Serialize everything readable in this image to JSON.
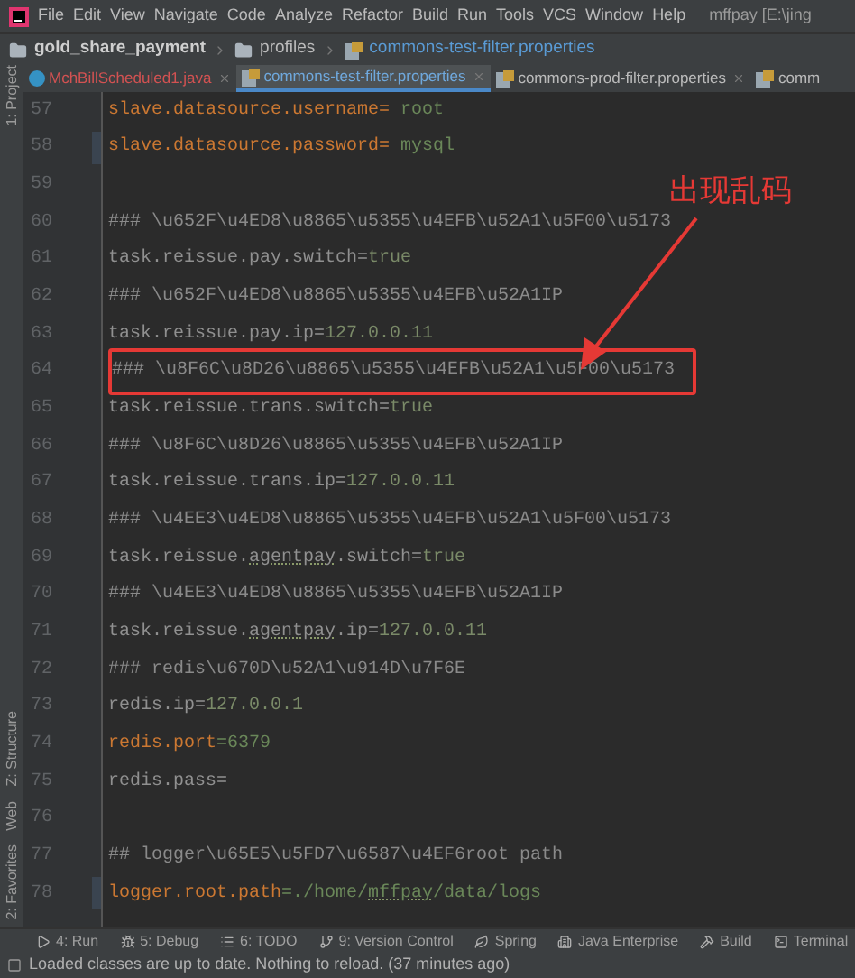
{
  "menu": {
    "items": [
      "File",
      "Edit",
      "View",
      "Navigate",
      "Code",
      "Analyze",
      "Refactor",
      "Build",
      "Run",
      "Tools",
      "VCS",
      "Window",
      "Help"
    ],
    "title": "mffpay [E:\\jing"
  },
  "breadcrumb": [
    {
      "label": "gold_share_payment",
      "kind": "project"
    },
    {
      "label": "profiles",
      "kind": "folder"
    },
    {
      "label": "commons-test-filter.properties",
      "kind": "file"
    }
  ],
  "side_tabs": {
    "top": [
      "1: Project"
    ],
    "bottom": [
      "Z: Structure",
      "Web",
      "2: Favorites"
    ]
  },
  "tabs": [
    {
      "label": "MchBillScheduled1.java",
      "kind": "java",
      "selected": false
    },
    {
      "label": "commons-test-filter.properties",
      "kind": "properties",
      "selected": true
    },
    {
      "label": "commons-prod-filter.properties",
      "kind": "properties",
      "selected": false
    },
    {
      "label": "comm",
      "kind": "properties",
      "selected": false
    }
  ],
  "lines": [
    {
      "number": "57",
      "modified": false,
      "boxed": false,
      "segments": [
        {
          "text": "slave.datasource.username=",
          "kind": "key"
        },
        {
          "text": " root",
          "kind": "value"
        }
      ]
    },
    {
      "number": "58",
      "modified": true,
      "boxed": false,
      "segments": [
        {
          "text": "slave.datasource.password=",
          "kind": "key"
        },
        {
          "text": " mysql",
          "kind": "value"
        }
      ]
    },
    {
      "number": "59",
      "modified": false,
      "boxed": false
    },
    {
      "number": "60",
      "modified": false,
      "boxed": false,
      "segments": [
        {
          "text": "### \\u652F\\u4ED8\\u8865\\u5355\\u4EFB\\u52A1\\u5F00\\u5173",
          "kind": "comment"
        }
      ]
    },
    {
      "number": "61",
      "modified": false,
      "boxed": false,
      "segments": [
        {
          "text": "task.reissue.pay.switch=",
          "kind": "unused_key"
        },
        {
          "text": "true",
          "kind": "unused_value"
        }
      ]
    },
    {
      "number": "62",
      "modified": false,
      "boxed": false,
      "segments": [
        {
          "text": "### \\u652F\\u4ED8\\u8865\\u5355\\u4EFB\\u52A1IP",
          "kind": "comment"
        }
      ]
    },
    {
      "number": "63",
      "modified": false,
      "boxed": false,
      "segments": [
        {
          "text": "task.reissue.pay.ip=",
          "kind": "unused_key"
        },
        {
          "text": "127.0.0.11",
          "kind": "unused_value"
        }
      ]
    },
    {
      "number": "64",
      "modified": false,
      "boxed": true,
      "segments": [
        {
          "text": "### \\u8F6C\\u8D26\\u8865\\u5355\\u4EFB\\u52A1\\u5F00\\u5173",
          "kind": "comment"
        }
      ]
    },
    {
      "number": "65",
      "modified": false,
      "boxed": false,
      "segments": [
        {
          "text": "task.reissue.trans.switch=",
          "kind": "unused_key"
        },
        {
          "text": "true",
          "kind": "unused_value"
        }
      ]
    },
    {
      "number": "66",
      "modified": false,
      "boxed": false,
      "segments": [
        {
          "text": "### \\u8F6C\\u8D26\\u8865\\u5355\\u4EFB\\u52A1IP",
          "kind": "comment"
        }
      ]
    },
    {
      "number": "67",
      "modified": false,
      "boxed": false,
      "segments": [
        {
          "text": "task.reissue.trans.ip=",
          "kind": "unused_key"
        },
        {
          "text": "127.0.0.11",
          "kind": "unused_value"
        }
      ]
    },
    {
      "number": "68",
      "modified": false,
      "boxed": false,
      "segments": [
        {
          "text": "### \\u4EE3\\u4ED8\\u8865\\u5355\\u4EFB\\u52A1\\u5F00\\u5173",
          "kind": "comment"
        }
      ]
    },
    {
      "number": "69",
      "modified": false,
      "boxed": false,
      "segments": [
        {
          "text": "task.reissue.",
          "kind": "unused_key"
        },
        {
          "text": "agentpay",
          "kind": "typo_key"
        },
        {
          "text": ".switch=",
          "kind": "unused_key"
        },
        {
          "text": "true",
          "kind": "unused_value"
        }
      ]
    },
    {
      "number": "70",
      "modified": false,
      "boxed": false,
      "segments": [
        {
          "text": "### \\u4EE3\\u4ED8\\u8865\\u5355\\u4EFB\\u52A1IP",
          "kind": "comment"
        }
      ]
    },
    {
      "number": "71",
      "modified": false,
      "boxed": false,
      "segments": [
        {
          "text": "task.reissue.",
          "kind": "unused_key"
        },
        {
          "text": "agentpay",
          "kind": "typo_key"
        },
        {
          "text": ".ip=",
          "kind": "unused_key"
        },
        {
          "text": "127.0.0.11",
          "kind": "unused_value"
        }
      ]
    },
    {
      "number": "72",
      "modified": false,
      "boxed": false,
      "segments": [
        {
          "text": "### redis\\u670D\\u52A1\\u914D\\u7F6E",
          "kind": "comment"
        }
      ]
    },
    {
      "number": "73",
      "modified": false,
      "boxed": false,
      "segments": [
        {
          "text": "redis.ip=",
          "kind": "unused_key"
        },
        {
          "text": "127.0.0.1",
          "kind": "unused_value"
        }
      ]
    },
    {
      "number": "74",
      "modified": false,
      "boxed": false,
      "segments": [
        {
          "text": "redis.port",
          "kind": "key"
        },
        {
          "text": "=6379",
          "kind": "value"
        }
      ]
    },
    {
      "number": "75",
      "modified": false,
      "boxed": false,
      "segments": [
        {
          "text": "redis.pass=",
          "kind": "unused_key"
        }
      ]
    },
    {
      "number": "76",
      "modified": false,
      "boxed": false
    },
    {
      "number": "77",
      "modified": false,
      "boxed": false,
      "segments": [
        {
          "text": "## logger\\u65E5\\u5FD7\\u6587\\u4EF6root path",
          "kind": "comment"
        }
      ]
    },
    {
      "number": "78",
      "modified": true,
      "boxed": false,
      "segments": [
        {
          "text": "logger.root.path",
          "kind": "key"
        },
        {
          "text": "=./home/",
          "kind": "value"
        },
        {
          "text": "mffpay",
          "kind": "typo_value"
        },
        {
          "text": "/data/logs",
          "kind": "value"
        }
      ]
    }
  ],
  "annotation": {
    "text": "出现乱码"
  },
  "tool_buttons": [
    {
      "label": "4: Run",
      "kind": "run"
    },
    {
      "label": "5: Debug",
      "kind": "debug"
    },
    {
      "label": "6: TODO",
      "kind": "todo"
    },
    {
      "label": "9: Version Control",
      "kind": "vcs"
    },
    {
      "label": "Spring",
      "kind": "spring"
    },
    {
      "label": "Java Enterprise",
      "kind": "enterprise"
    },
    {
      "label": "Build",
      "kind": "build"
    },
    {
      "label": "Terminal",
      "kind": "terminal"
    }
  ],
  "status_bar": {
    "message": "Loaded classes are up to date. Nothing to reload. (37 minutes ago)"
  }
}
